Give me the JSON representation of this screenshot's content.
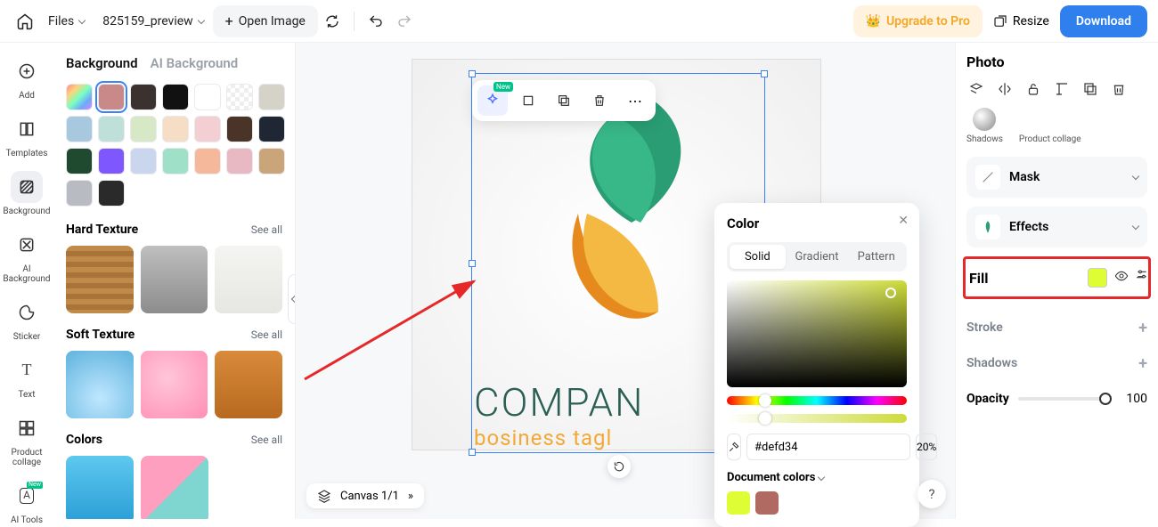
{
  "topbar": {
    "files_label": "Files",
    "filename": "825159_preview",
    "open_image": "Open Image",
    "upgrade": "Upgrade to Pro",
    "resize": "Resize",
    "download": "Download"
  },
  "rail": {
    "add": "Add",
    "templates": "Templates",
    "background": "Background",
    "ai_background": "AI Background",
    "sticker": "Sticker",
    "text": "Text",
    "product_collage": "Product collage",
    "ai_tools": "AI Tools"
  },
  "bgpanel": {
    "tab_bg": "Background",
    "tab_ai": "AI Background",
    "see_all": "See all",
    "hard": "Hard Texture",
    "soft": "Soft Texture",
    "colors": "Colors",
    "swatches": [
      "linear-gradient(135deg,#ff8a8a,#ffd37a,#7affc1,#6ea8ff,#d38aff)",
      "#c98989",
      "#3b322f",
      "#111111",
      "#ffffff",
      "repeating-conic-gradient(#eee 0 25%,#fff 0 50%) 50%/10px 10px",
      "#d5d2c8",
      "#a7c8de",
      "#bfe0d9",
      "#d6e8c5",
      "#f6ddc5",
      "#f3cfd3",
      "#4a3327",
      "#1e2733",
      "#1f4a2f",
      "#7e57ff",
      "#c9d6ee",
      "#9fe0c9",
      "#f5b89a",
      "#e8b9c2",
      "#cba57a",
      "#b8bcc2",
      "#2a2a2a"
    ],
    "hard_tex": [
      "repeating-linear-gradient(#c08a4a, #c08a4a 6px, #a9733a 6px, #a9733a 12px)",
      "linear-gradient(#bfbfbf,#8c8c8c)",
      "linear-gradient(#f4f4f2,#e6e6e2)"
    ],
    "soft_tex": [
      "radial-gradient(circle at 50% 70%, #bfe7ff, #5fb3dd)",
      "radial-gradient(circle at 40% 40%, #ffc6d9, #ff8fb4)",
      "linear-gradient(#d98a3a,#b76a20)"
    ],
    "color_tex": [
      "linear-gradient(#5ec8ef,#2a9ed6)",
      "linear-gradient(135deg,#ff9fbf 50%,#7fd6d0 50%)"
    ]
  },
  "canvas": {
    "company": "COMPAN",
    "tagline": "bosiness tagl",
    "bar": "Canvas 1/1",
    "help": "?",
    "ai_badge": "New"
  },
  "picker": {
    "title": "Color",
    "tab_solid": "Solid",
    "tab_gradient": "Gradient",
    "tab_pattern": "Pattern",
    "hex": "#defd34",
    "opacity": "20%",
    "doc_colors": "Document colors",
    "doc_swatches": [
      "#defd34",
      "#b06a62"
    ]
  },
  "right": {
    "title": "Photo",
    "shadows_q": "Shadows",
    "collage_q": "Product collage",
    "mask": "Mask",
    "effects": "Effects",
    "fill": "Fill",
    "stroke": "Stroke",
    "shadows": "Shadows",
    "opacity": "Opacity",
    "opacity_val": "100"
  }
}
